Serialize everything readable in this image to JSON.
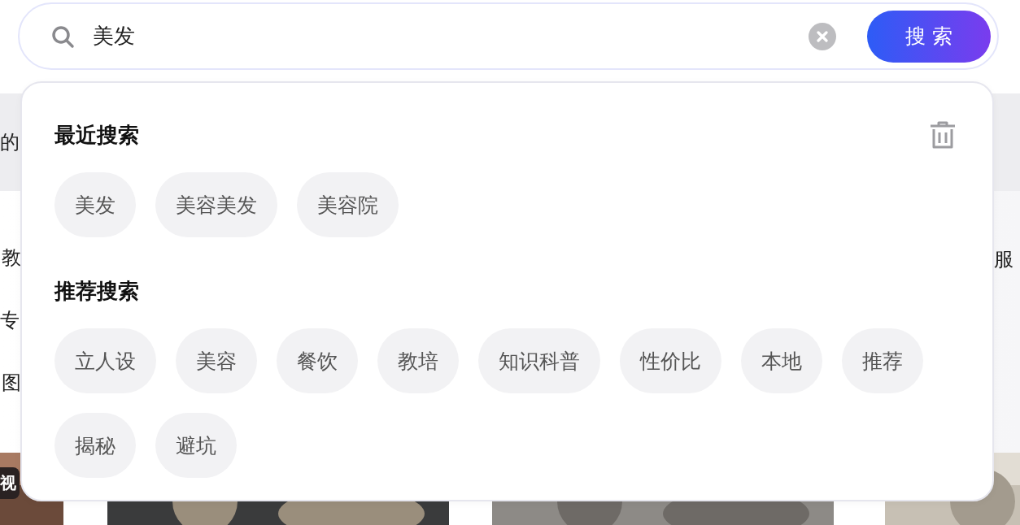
{
  "search": {
    "value": "美发",
    "button": "搜 索"
  },
  "background": {
    "band_text": "的",
    "left_texts": [
      "教",
      "专",
      "图"
    ],
    "right_text": "服"
  },
  "thumbnails": [
    {
      "kind": "picture",
      "badge": "视"
    },
    {
      "kind": "picture"
    },
    {
      "kind": "picture"
    },
    {
      "kind": "picture"
    }
  ],
  "suggestions": {
    "sections": [
      {
        "title": "最近搜索",
        "deletable": true,
        "items": [
          "美发",
          "美容美发",
          "美容院"
        ]
      },
      {
        "title": "推荐搜索",
        "deletable": false,
        "items": [
          "立人设",
          "美容",
          "餐饮",
          "教培",
          "知识科普",
          "性价比",
          "本地",
          "推荐",
          "揭秘",
          "避坑"
        ]
      }
    ]
  }
}
